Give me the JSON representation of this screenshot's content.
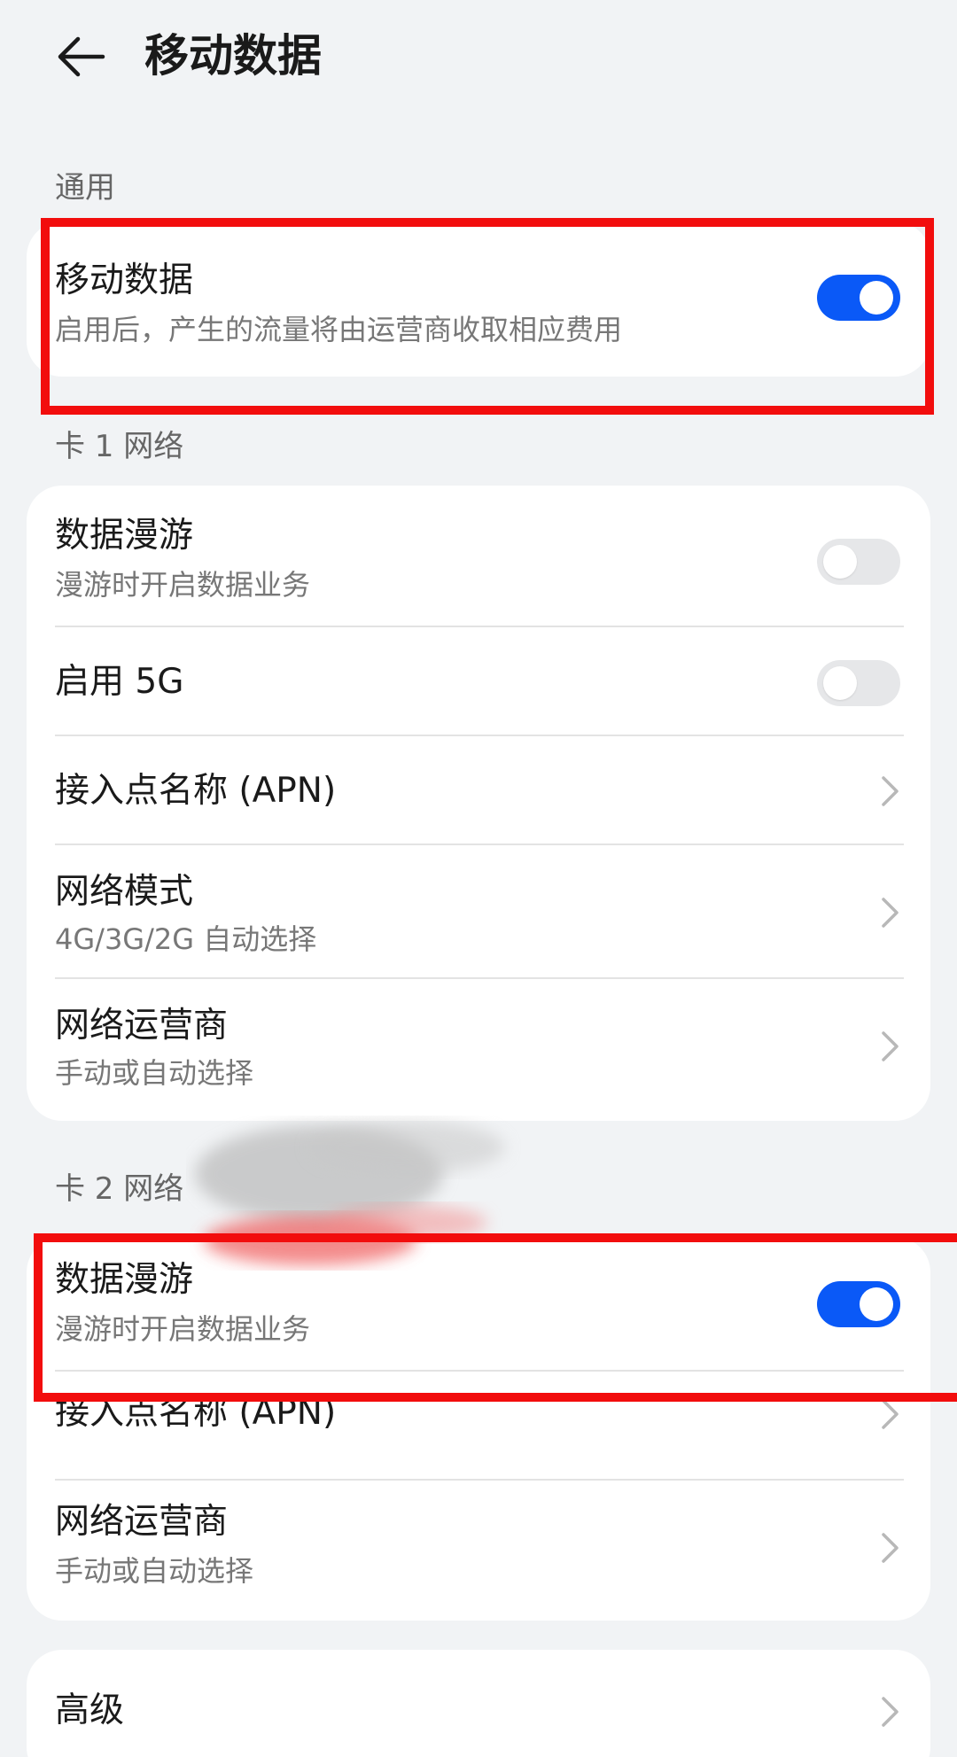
{
  "header": {
    "title": "移动数据"
  },
  "general": {
    "label": "通用",
    "mobile_data": {
      "title": "移动数据",
      "subtitle": "启用后，产生的流量将由运营商收取相应费用",
      "on": true
    }
  },
  "card1": {
    "label": "卡 1 网络",
    "roaming": {
      "title": "数据漫游",
      "subtitle": "漫游时开启数据业务",
      "on": false
    },
    "enable5g": {
      "title": "启用 5G",
      "on": false
    },
    "apn": {
      "title": "接入点名称 (APN)"
    },
    "network_mode": {
      "title": "网络模式",
      "subtitle": "4G/3G/2G 自动选择"
    },
    "carrier": {
      "title": "网络运营商",
      "subtitle": "手动或自动选择"
    }
  },
  "card2": {
    "label": "卡 2 网络",
    "roaming": {
      "title": "数据漫游",
      "subtitle": "漫游时开启数据业务",
      "on": true
    },
    "apn": {
      "title": "接入点名称 (APN)"
    },
    "carrier": {
      "title": "网络运营商",
      "subtitle": "手动或自动选择"
    }
  },
  "advanced": {
    "title": "高级"
  },
  "colors": {
    "accent": "#0a59f7",
    "annotation": "#f20d0d",
    "background": "#f1f3f5"
  },
  "icons": {
    "back": "arrow-left-icon",
    "chevron": "chevron-right-icon"
  }
}
